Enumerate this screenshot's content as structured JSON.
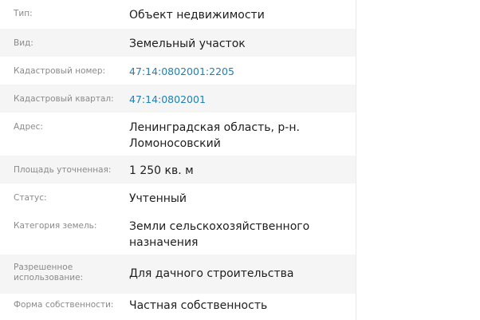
{
  "properties": [
    {
      "label": "Тип:",
      "value": "Объект недвижимости"
    },
    {
      "label": "Вид:",
      "value": "Земельный участок"
    },
    {
      "label": "Кадастровый номер:",
      "value": "47:14:0802001:2205"
    },
    {
      "label": "Кадастровый квартал:",
      "value": "47:14:0802001"
    },
    {
      "label": "Адрес:",
      "value": "Ленинградская область, р-н. Ломоносовский"
    },
    {
      "label": "Площадь уточненная:",
      "value": "1 250 кв. м"
    },
    {
      "label": "Статус:",
      "value": "Учтенный"
    },
    {
      "label": "Категория земель:",
      "value": "Земли сельскохозяйственного назначения"
    },
    {
      "label": "Разрешенное использование:",
      "value": "Для дачного строительства"
    },
    {
      "label": "Форма собственности:",
      "value": "Частная собственность"
    }
  ],
  "colors": {
    "label": "#8a8a8a",
    "value": "#1e1e1e",
    "link": "#1f7fb6",
    "row_alt": "#f5f5f5"
  }
}
